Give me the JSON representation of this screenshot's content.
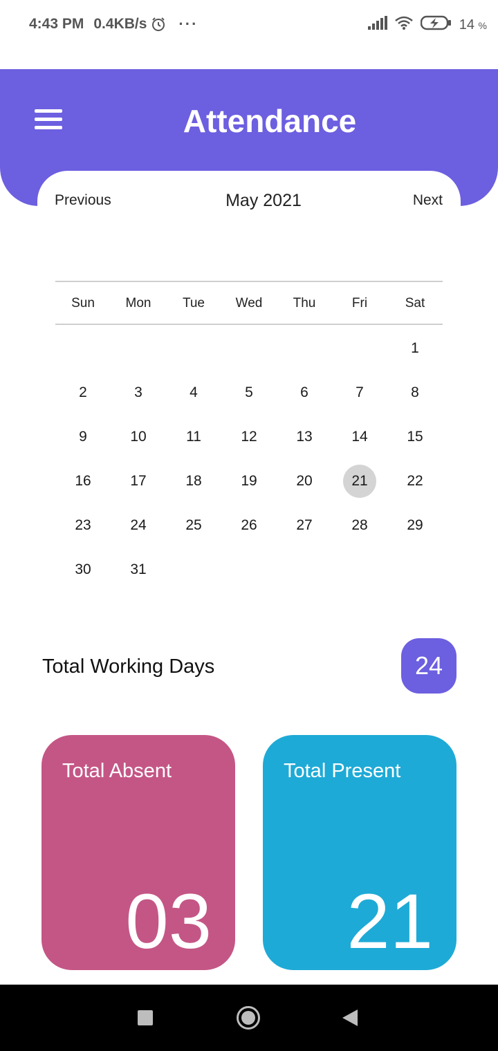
{
  "status_bar": {
    "time": "4:43 PM",
    "net_speed": "0.4KB/s",
    "more": "···",
    "battery": "14",
    "battery_unit": "%",
    "icons": [
      "alarm-icon",
      "signal-icon",
      "wifi-icon",
      "battery-charging-icon"
    ]
  },
  "header": {
    "title": "Attendance",
    "menu_icon": "hamburger-menu-icon",
    "color": "#6c5fe0"
  },
  "calendar": {
    "prev_label": "Previous",
    "next_label": "Next",
    "month_label": "May 2021",
    "weekdays": [
      "Sun",
      "Mon",
      "Tue",
      "Wed",
      "Thu",
      "Fri",
      "Sat"
    ],
    "first_weekday_index": 6,
    "days_in_month": 31,
    "selected_day": 21,
    "selected_color": "#d4d4d4"
  },
  "summary": {
    "working_days_label": "Total Working Days",
    "working_days_value": "24",
    "absent_label": "Total Absent",
    "absent_value": "03",
    "absent_color": "#c45686",
    "present_label": "Total Present",
    "present_value": "21",
    "present_color": "#1eaad6"
  },
  "system_nav": {
    "icons": [
      "recents-square-icon",
      "home-circle-icon",
      "back-triangle-icon"
    ]
  }
}
